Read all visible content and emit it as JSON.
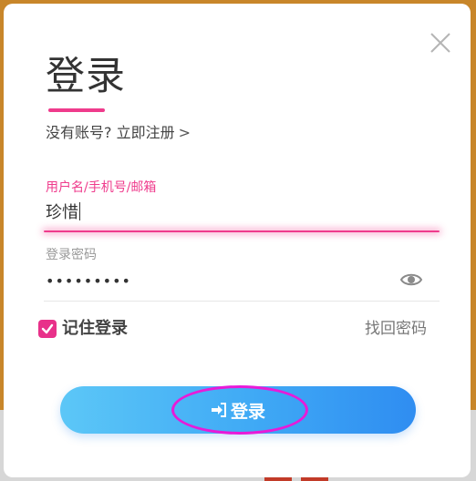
{
  "dialog": {
    "title": "登录",
    "register_prompt": "没有账号?",
    "register_link": "立即注册",
    "register_chevron": ">",
    "username": {
      "label": "用户名/手机号/邮箱",
      "value": "珍惜"
    },
    "password": {
      "label": "登录密码",
      "masked_value": "•••••••••"
    },
    "remember_me": {
      "label": "记住登录",
      "checked": true
    },
    "forgot_password": "找回密码",
    "login_button": "登录"
  },
  "colors": {
    "accent_pink": "#ef3b8c",
    "button_gradient_start": "#5cc7f7",
    "button_gradient_end": "#2f8df1",
    "annotation_magenta": "#e81ad8"
  },
  "icons": {
    "close": "close-icon",
    "eye": "eye-icon",
    "check": "check-icon",
    "login": "sign-in-icon"
  }
}
